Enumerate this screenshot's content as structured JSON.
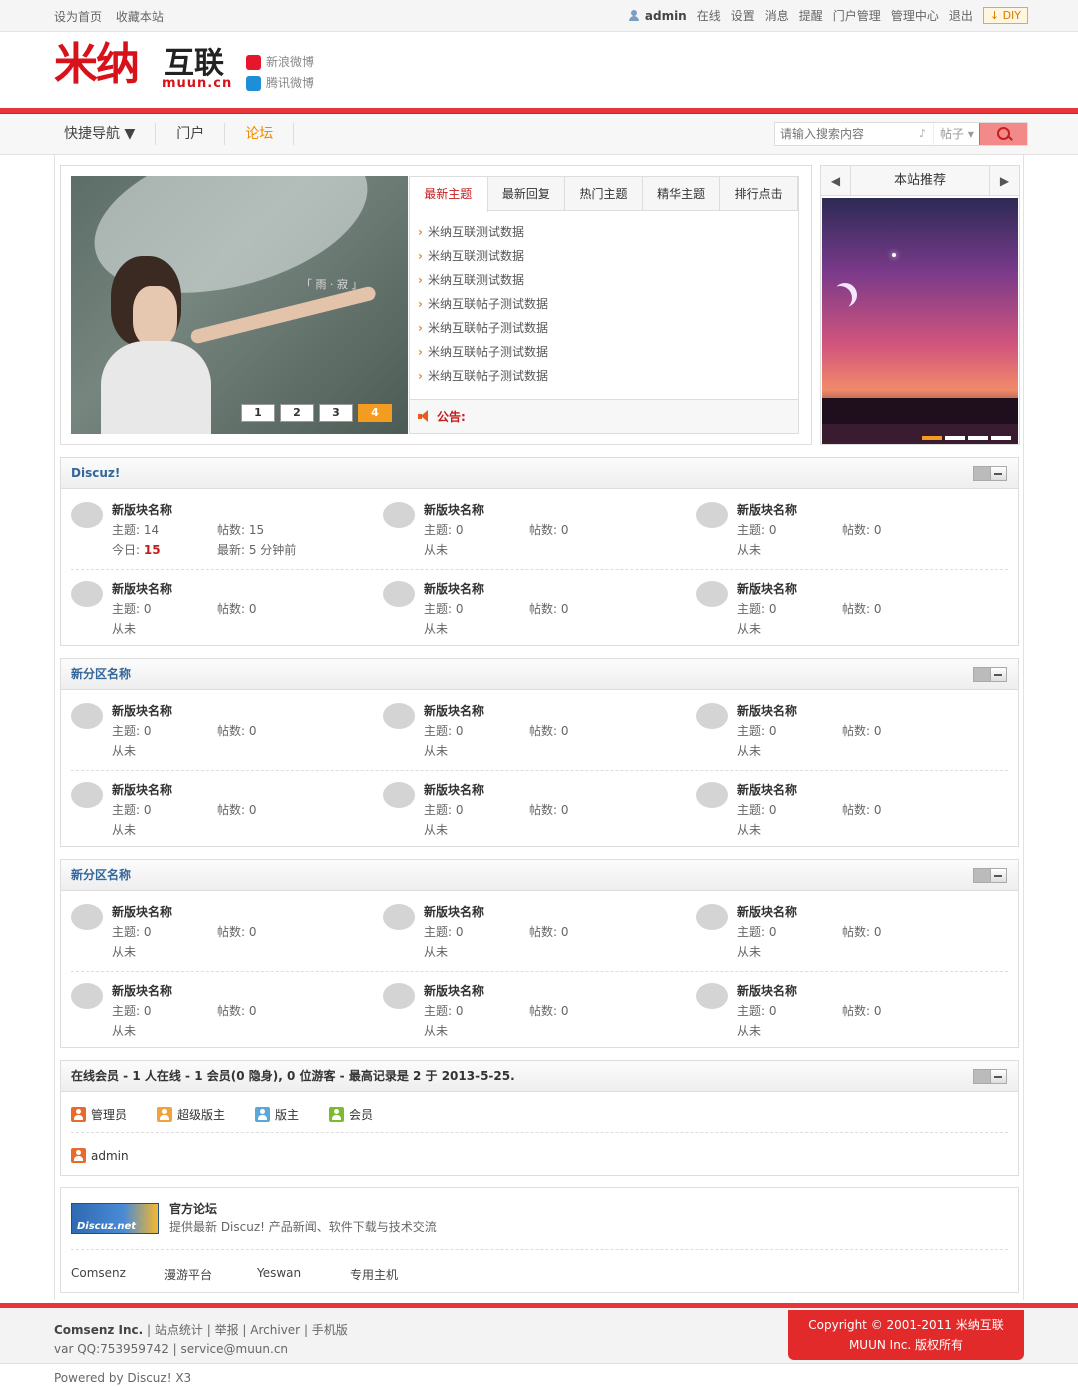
{
  "topbar": {
    "set_home": "设为首页",
    "bookmark": "收藏本站",
    "username": "admin",
    "links": [
      "在线",
      "设置",
      "消息",
      "提醒",
      "门户管理",
      "管理中心",
      "退出"
    ],
    "diy": "DIY"
  },
  "header": {
    "logo_main": "米纳",
    "logo_sub": "互联",
    "logo_domain": "muun.cn",
    "weibo_sina": "新浪微博",
    "weibo_qq": "腾讯微博"
  },
  "nav": {
    "items": [
      "快捷导航 ▼",
      "门户",
      "论坛"
    ],
    "search_placeholder": "请输入搜索内容",
    "search_type": "帖子 ▾"
  },
  "slide": {
    "caption": "「 雨 · 寂 」",
    "pages": [
      "1",
      "2",
      "3",
      "4"
    ],
    "active_page": "4"
  },
  "tabs": {
    "labels": [
      "最新主题",
      "最新回复",
      "热门主题",
      "精华主题",
      "排行点击"
    ],
    "items": [
      "米纳互联测试数据",
      "米纳互联测试数据",
      "米纳互联测试数据",
      "米纳互联帖子测试数据",
      "米纳互联帖子测试数据",
      "米纳互联帖子测试数据",
      "米纳互联帖子测试数据"
    ],
    "notice": "公告:"
  },
  "recommend": {
    "title": "本站推荐",
    "prev": "◀",
    "next": "▶"
  },
  "categories": [
    {
      "title": "Discuz!",
      "forums": [
        {
          "name": "新版块名称",
          "threads": "主题: 14",
          "posts": "帖数: 15",
          "today": "今日: ",
          "today_n": "15",
          "last": "最新: 5 分钟前"
        },
        {
          "name": "新版块名称",
          "threads": "主题: 0",
          "posts": "帖数: 0",
          "last": "从未"
        },
        {
          "name": "新版块名称",
          "threads": "主题: 0",
          "posts": "帖数: 0",
          "last": "从未"
        },
        {
          "name": "新版块名称",
          "threads": "主题: 0",
          "posts": "帖数: 0",
          "last": "从未"
        },
        {
          "name": "新版块名称",
          "threads": "主题: 0",
          "posts": "帖数: 0",
          "last": "从未"
        },
        {
          "name": "新版块名称",
          "threads": "主题: 0",
          "posts": "帖数: 0",
          "last": "从未"
        }
      ]
    },
    {
      "title": "新分区名称",
      "forums": [
        {
          "name": "新版块名称",
          "threads": "主题: 0",
          "posts": "帖数: 0",
          "last": "从未"
        },
        {
          "name": "新版块名称",
          "threads": "主题: 0",
          "posts": "帖数: 0",
          "last": "从未"
        },
        {
          "name": "新版块名称",
          "threads": "主题: 0",
          "posts": "帖数: 0",
          "last": "从未"
        },
        {
          "name": "新版块名称",
          "threads": "主题: 0",
          "posts": "帖数: 0",
          "last": "从未"
        },
        {
          "name": "新版块名称",
          "threads": "主题: 0",
          "posts": "帖数: 0",
          "last": "从未"
        },
        {
          "name": "新版块名称",
          "threads": "主题: 0",
          "posts": "帖数: 0",
          "last": "从未"
        }
      ]
    },
    {
      "title": "新分区名称",
      "forums": [
        {
          "name": "新版块名称",
          "threads": "主题: 0",
          "posts": "帖数: 0",
          "last": "从未"
        },
        {
          "name": "新版块名称",
          "threads": "主题: 0",
          "posts": "帖数: 0",
          "last": "从未"
        },
        {
          "name": "新版块名称",
          "threads": "主题: 0",
          "posts": "帖数: 0",
          "last": "从未"
        },
        {
          "name": "新版块名称",
          "threads": "主题: 0",
          "posts": "帖数: 0",
          "last": "从未"
        },
        {
          "name": "新版块名称",
          "threads": "主题: 0",
          "posts": "帖数: 0",
          "last": "从未"
        },
        {
          "name": "新版块名称",
          "threads": "主题: 0",
          "posts": "帖数: 0",
          "last": "从未"
        }
      ]
    }
  ],
  "online": {
    "title": "在线会员 - 1 人在线 - 1 会员(0 隐身), 0 位游客 - 最高记录是 2 于 2013-5-25.",
    "legend": [
      "管理员",
      "超级版主",
      "版主",
      "会员"
    ],
    "users": [
      "admin"
    ]
  },
  "links": {
    "logo_text": "Discuz.net",
    "title": "官方论坛",
    "desc": "提供最新 Discuz! 产品新闻、软件下载与技术交流",
    "text_links": [
      "Comsenz",
      "漫游平台",
      "Yeswan",
      "专用主机"
    ]
  },
  "footer": {
    "company": "Comsenz Inc.",
    "links": [
      "站点统计",
      "举报",
      "Archiver",
      "手机版"
    ],
    "contact": "var QQ:753959742 | service@muun.cn",
    "copy1": "Copyright © 2001-2011 米纳互联",
    "copy2": "MUUN Inc. 版权所有",
    "powered": "Powered by Discuz! X3"
  },
  "colors": {
    "accent": "#e8343b",
    "link": "#336699",
    "highlight": "#f08c00"
  }
}
